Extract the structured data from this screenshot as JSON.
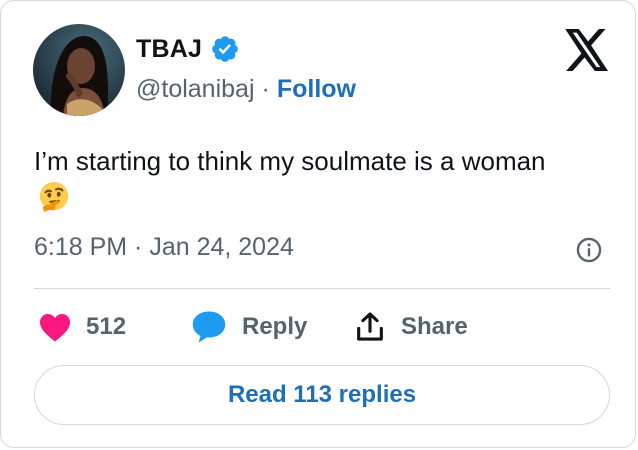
{
  "author": {
    "name": "TBAJ",
    "handle": "@tolanibaj",
    "separator": "·",
    "follow_label": "Follow"
  },
  "tweet": {
    "text": "I’m starting to think my soulmate is a woman",
    "emoji": "thinking-face",
    "timestamp": "6:18 PM · Jan 24, 2024"
  },
  "actions": {
    "likes_count": "512",
    "reply_label": "Reply",
    "share_label": "Share"
  },
  "read_replies_label": "Read 113 replies",
  "colors": {
    "accent": "#1d6fb8",
    "verified": "#1d9bf0",
    "like": "#f91880",
    "reply_bubble": "#1d9bf0",
    "muted": "#536471",
    "border": "#cfd9de"
  }
}
